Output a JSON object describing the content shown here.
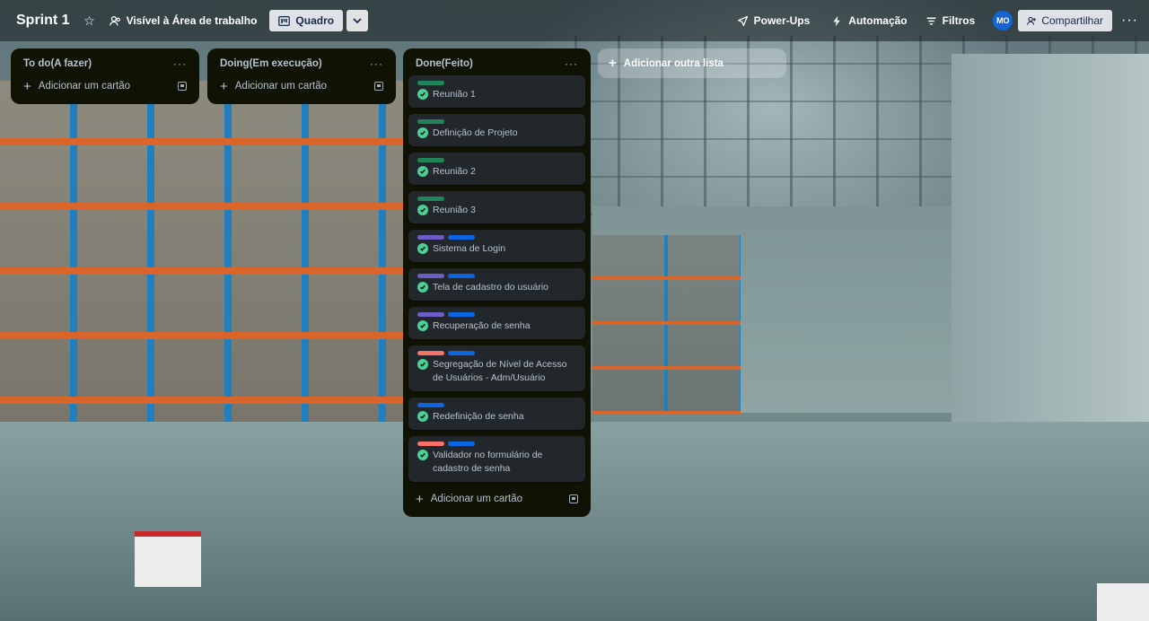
{
  "board": {
    "title": "Sprint 1",
    "visibility": "Visível à Área de trabalho",
    "view": "Quadro"
  },
  "toolbar": {
    "powerups": "Power-Ups",
    "automation": "Automação",
    "filters": "Filtros",
    "avatar_initials": "MO",
    "share": "Compartilhar"
  },
  "lists": [
    {
      "title": "To do(A fazer)",
      "add_card": "Adicionar um cartão"
    },
    {
      "title": "Doing(Em execução)",
      "add_card": "Adicionar um cartão"
    },
    {
      "title": "Done(Feito)",
      "add_card": "Adicionar um cartão",
      "cards": [
        {
          "title": "Reunião 1",
          "labels": [
            "#1f845a"
          ],
          "done": true
        },
        {
          "title": "Definição de Projeto",
          "labels": [
            "#1f845a"
          ],
          "done": true
        },
        {
          "title": "Reunião 2",
          "labels": [
            "#1f845a"
          ],
          "done": true
        },
        {
          "title": "Reunião 3",
          "labels": [
            "#1f845a"
          ],
          "done": true
        },
        {
          "title": "Sistema de Login",
          "labels": [
            "#6e5dc6",
            "#0c66e4"
          ],
          "done": true
        },
        {
          "title": "Tela de cadastro do usuário",
          "labels": [
            "#6e5dc6",
            "#0c66e4"
          ],
          "done": true
        },
        {
          "title": "Recuperação de senha",
          "labels": [
            "#6e5dc6",
            "#0c66e4"
          ],
          "done": true
        },
        {
          "title": "Segregação de Nível de Acesso de Usuários - Adm/Usuário",
          "labels": [
            "#f87168",
            "#0c66e4"
          ],
          "done": true
        },
        {
          "title": "Redefinição de senha",
          "labels": [
            "#0c66e4"
          ],
          "done": true
        },
        {
          "title": "Validador no formulário de cadastro de senha",
          "labels": [
            "#f87168",
            "#0c66e4"
          ],
          "done": true
        }
      ]
    }
  ],
  "add_list": "Adicionar outra lista",
  "colors": {
    "list_bg": "#101204",
    "card_bg": "#22272b",
    "check_green": "#4bce97"
  }
}
